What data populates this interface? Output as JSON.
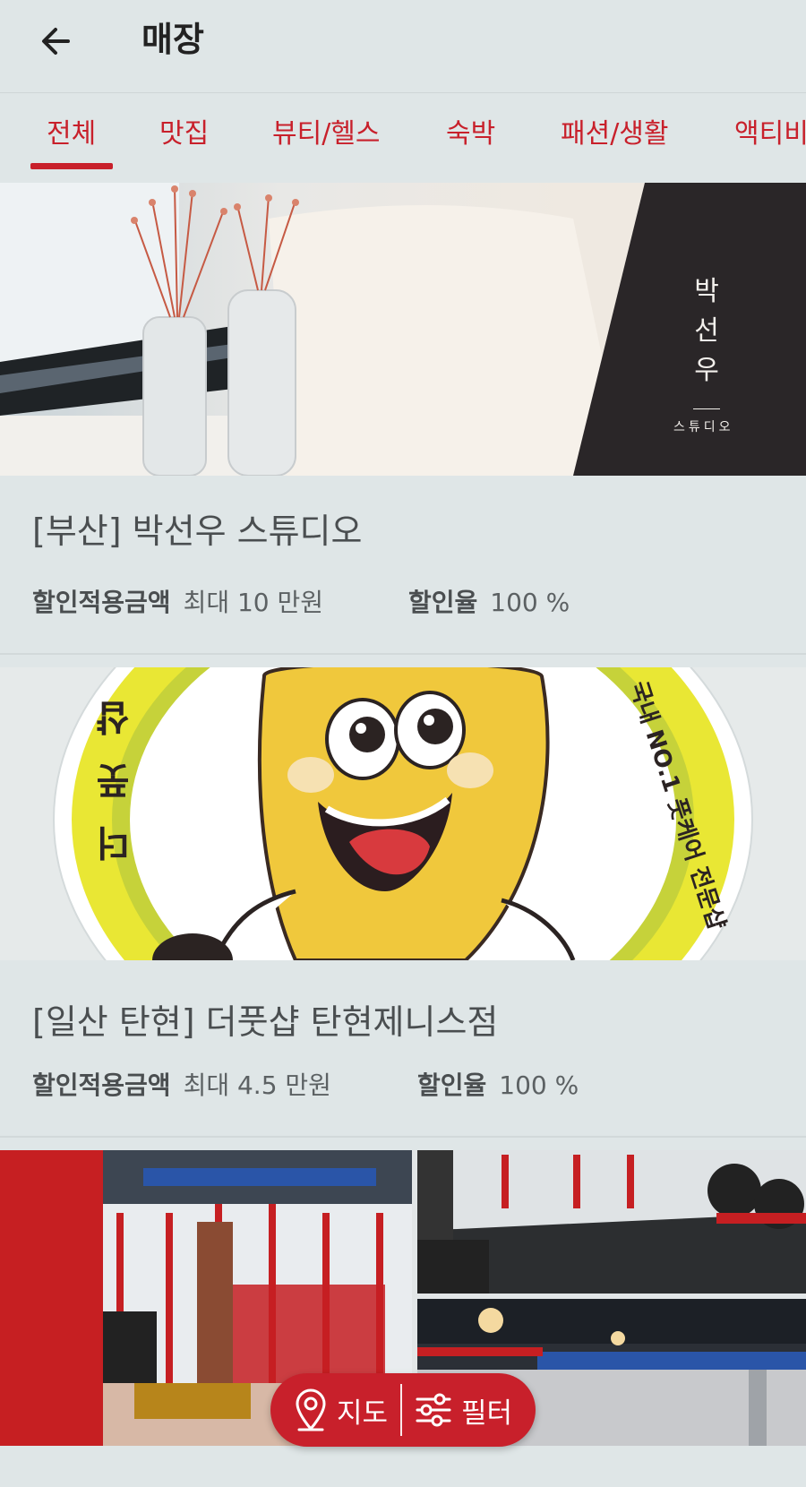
{
  "header": {
    "title": "매장"
  },
  "tabs": [
    {
      "label": "전체",
      "active": true
    },
    {
      "label": "맛집"
    },
    {
      "label": "뷰티/헬스"
    },
    {
      "label": "숙박"
    },
    {
      "label": "패션/생활"
    },
    {
      "label": "액티비"
    }
  ],
  "stores": [
    {
      "title": "[부산] 박선우 스튜디오",
      "discount_amount_label": "할인적용금액",
      "discount_amount_value": "최대 10 만원",
      "discount_rate_label": "할인율",
      "discount_rate_value": "100 %",
      "image_text": "박선우",
      "image_subtext": "스튜디오"
    },
    {
      "title": "[일산 탄현] 더풋샵 탄현제니스점",
      "discount_amount_label": "할인적용금액",
      "discount_amount_value": "최대 4.5 만원",
      "discount_rate_label": "할인율",
      "discount_rate_value": "100 %",
      "image_text_left": "더풋샵",
      "image_text_right": "국내 NO.1 풋케어 전문샵"
    }
  ],
  "fab": {
    "map_label": "지도",
    "filter_label": "필터"
  },
  "colors": {
    "accent": "#c8202b",
    "background": "#dfe6e7"
  }
}
